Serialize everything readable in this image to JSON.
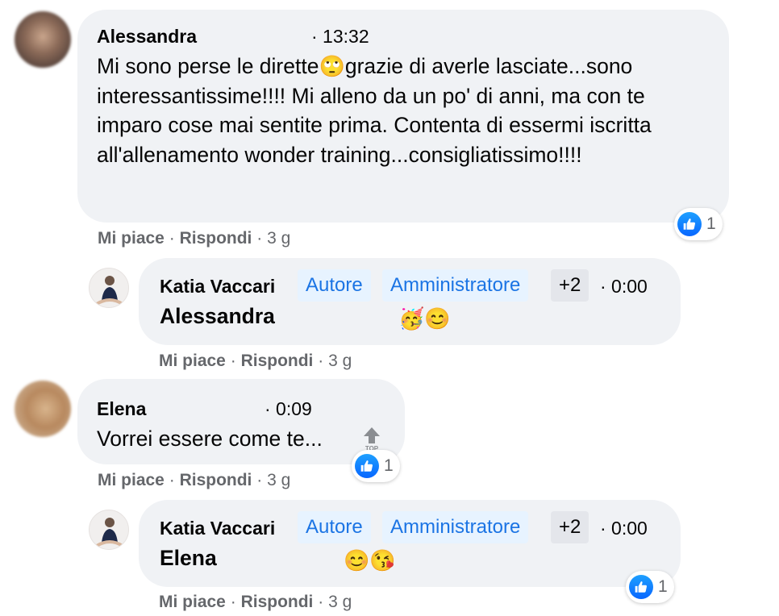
{
  "comments": [
    {
      "author": "Alessandra",
      "time": "· 13:32",
      "text_part1": "Mi sono perse le dirette",
      "emoji_inline": "🙄",
      "text_part2": "grazie di averle lasciate...sono interessantissime!!!! Mi alleno da un po' di anni, ma con te imparo cose mai sentite prima. Contenta di essermi iscritta all'allenamento wonder training...consigliatissimo!!!!",
      "like_label": "Mi piace",
      "reply_label": "Rispondi",
      "age": "3 g",
      "reaction_count": "1",
      "reply": {
        "author": "Katia Vaccari",
        "badges": [
          "Autore",
          "Amministratore",
          "+2"
        ],
        "time": "· 0:00",
        "mention": "Alessandra",
        "emojis": "🥳😊",
        "like_label": "Mi piace",
        "reply_label": "Rispondi",
        "age": "3 g"
      }
    },
    {
      "author": "Elena",
      "time": "· 0:09",
      "text": "Vorrei essere come te...",
      "top_label": "TOP",
      "like_label": "Mi piace",
      "reply_label": "Rispondi",
      "age": "3 g",
      "reaction_count": "1",
      "reply": {
        "author": "Katia Vaccari",
        "badges": [
          "Autore",
          "Amministratore",
          "+2"
        ],
        "time": "· 0:00",
        "mention": "Elena",
        "emojis": "😊😘",
        "like_label": "Mi piace",
        "reply_label": "Rispondi",
        "age": "3 g",
        "reaction_count": "1"
      }
    }
  ],
  "separator": "·",
  "icons": {
    "reaction": "like-thumbs-up-icon",
    "top": "top-arrow-icon"
  },
  "colors": {
    "bubble": "#f0f2f5",
    "badge_bg": "#e7f3ff",
    "badge_text": "#1b74e4",
    "like_blue": "#0866ff",
    "secondary_text": "#65676b"
  }
}
